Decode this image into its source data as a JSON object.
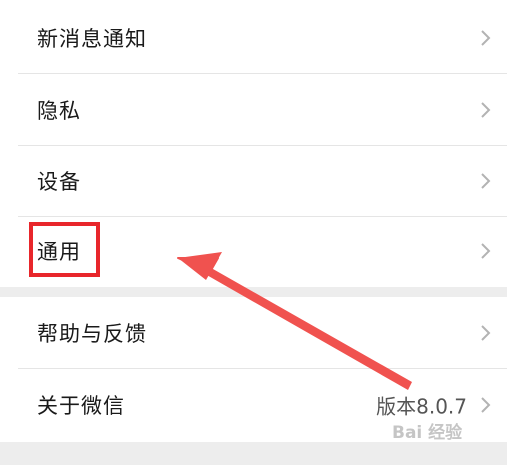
{
  "settings": {
    "group1": [
      {
        "label": "新消息通知"
      },
      {
        "label": "隐私"
      },
      {
        "label": "设备"
      },
      {
        "label": "通用"
      }
    ],
    "group2": [
      {
        "label": "帮助与反馈"
      },
      {
        "label": "关于微信",
        "value": "版本8.0.7"
      }
    ]
  },
  "watermark": "Bai 经验",
  "annotation": {
    "highlight_color": "#e8262b",
    "arrow_color": "#f0524f"
  },
  "colors": {
    "background": "#ffffff",
    "separator": "#ededed",
    "text": "#1a1a1a",
    "chevron": "#b3b3b3"
  }
}
